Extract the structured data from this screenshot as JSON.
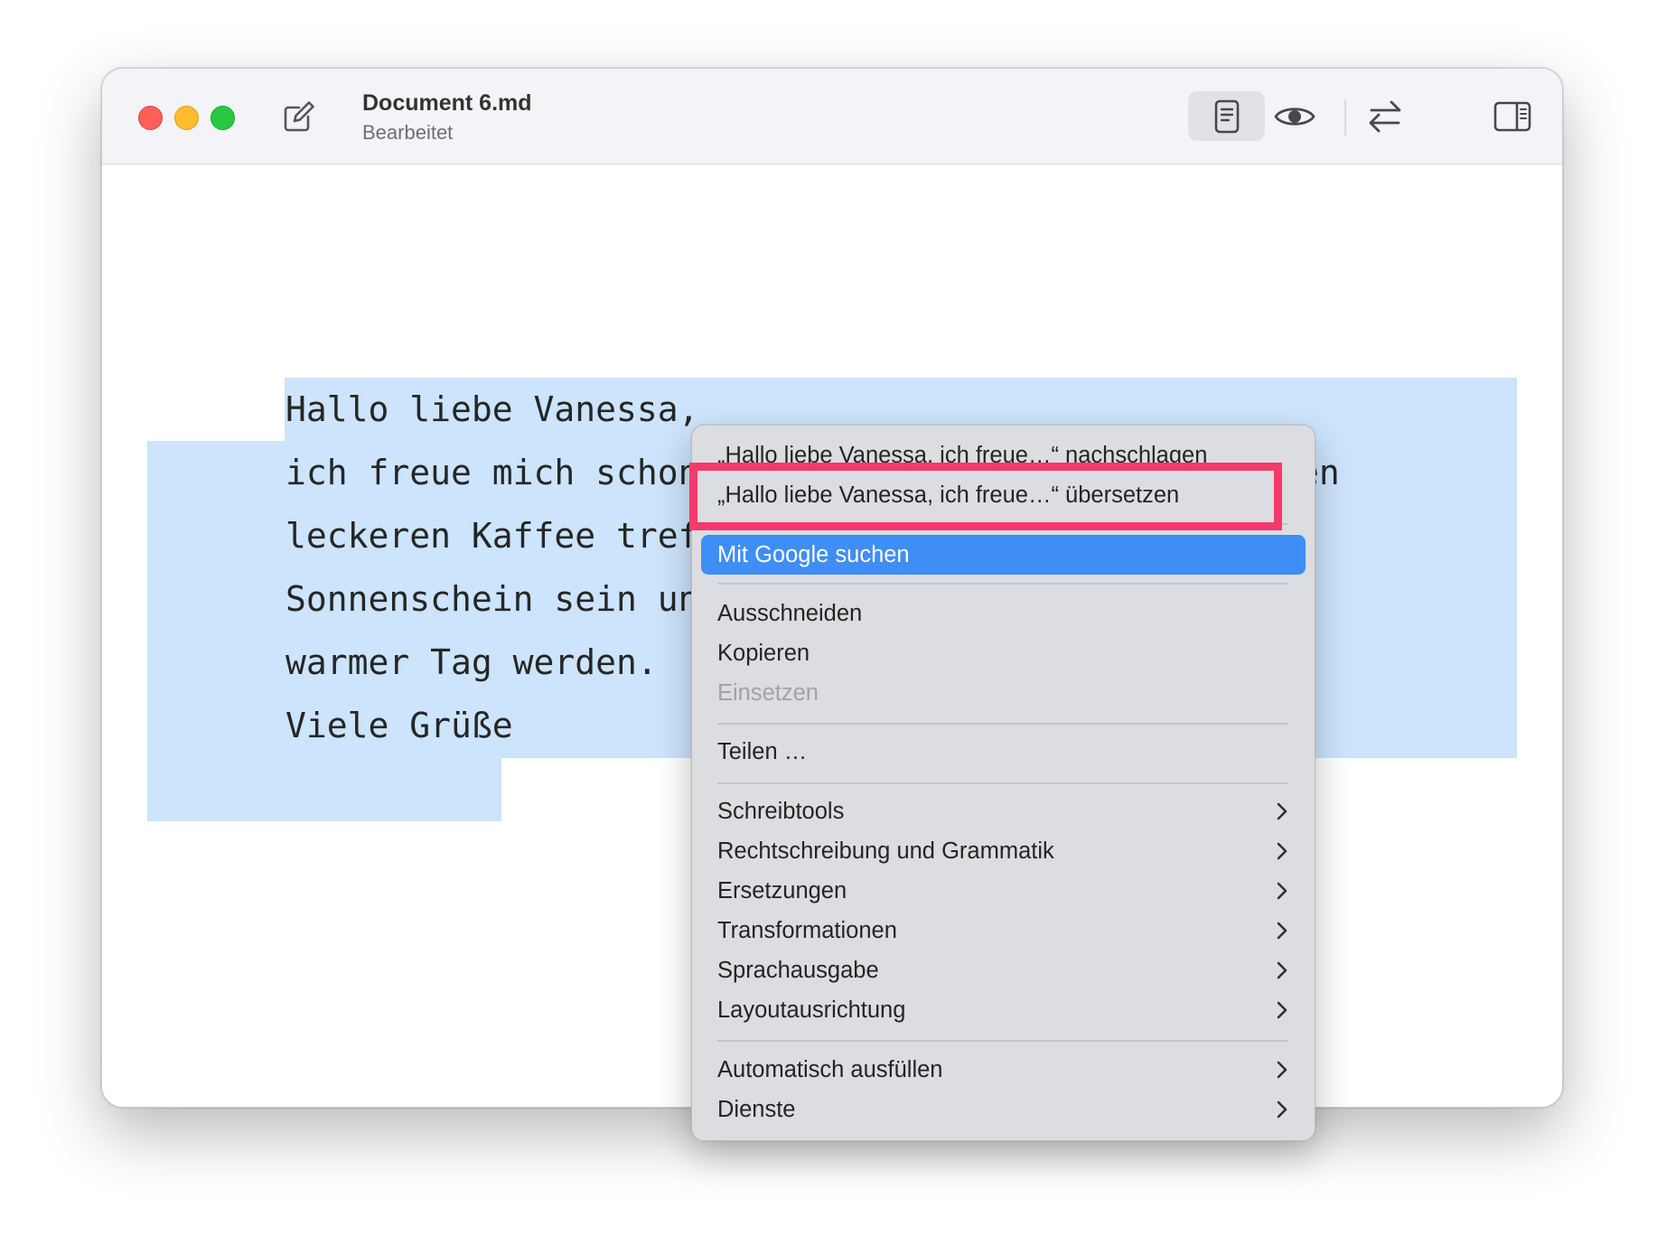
{
  "window": {
    "title": "Document 6.md",
    "subtitle": "Bearbeitet"
  },
  "toolbar": {
    "icons": [
      "compose-icon",
      "editor-mode-icon",
      "preview-eye-icon",
      "swap-arrows-icon",
      "sidebar-toggle-icon"
    ]
  },
  "editor": {
    "lines": [
      "Hallo liebe Vanessa,",
      "ich freue mich schon, wenn wir uns morgen auf einen",
      "leckeren Kaffee treff",
      "Sonnenschein sein und",
      "warmer Tag werden.",
      "Viele Grüße"
    ],
    "selection_color": "#cce4fc"
  },
  "context_menu": {
    "lookup": "„Hallo liebe Vanessa, ich freue…“ nachschlagen",
    "translate": "„Hallo liebe Vanessa, ich freue…“ übersetzen",
    "google_search": "Mit Google suchen",
    "cut": "Ausschneiden",
    "copy": "Kopieren",
    "paste": "Einsetzen",
    "share": "Teilen …",
    "writing_tools": "Schreibtools",
    "spelling": "Rechtschreibung und Grammatik",
    "substitutions": "Ersetzungen",
    "transformations": "Transformationen",
    "speech": "Sprachausgabe",
    "layout_orientation": "Layoutausrichtung",
    "autofill": "Automatisch ausfüllen",
    "services": "Dienste",
    "hover_color": "#3e8ef6"
  },
  "annotation": {
    "highlight_color": "#f33a6a"
  }
}
